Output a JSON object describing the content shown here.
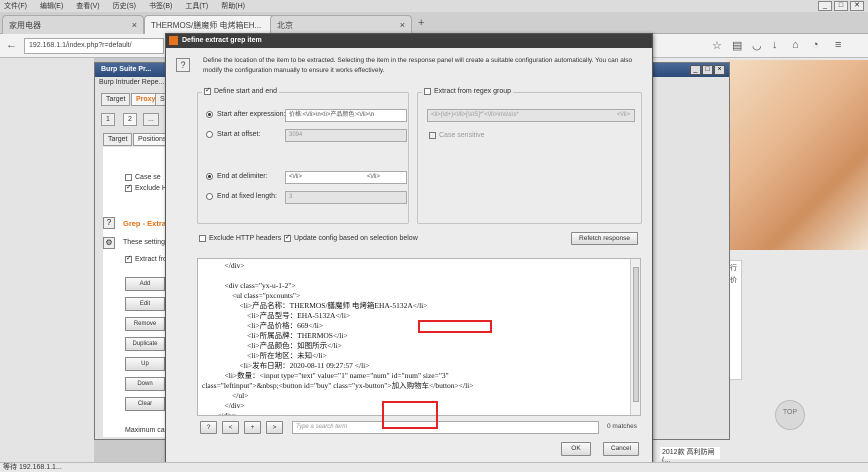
{
  "browser": {
    "menu": [
      "文件(F)",
      "编辑(E)",
      "查看(V)",
      "历史(S)",
      "书签(B)",
      "工具(T)",
      "帮助(H)"
    ],
    "tabs": [
      {
        "label": "家用电器"
      },
      {
        "label": "THERMOS/膳魔师 电烤箱EH..."
      },
      {
        "label": "北京"
      }
    ],
    "url": "192.168.1.1/index.php?r=default/",
    "status": "等待 192.168.1.1...",
    "right_side_text": "逛行\n降价\n有\n原",
    "footer_text": "2012款 高利防闸(...",
    "back_to_top": "TOP"
  },
  "burp": {
    "title": "Burp Suite Pr...",
    "menu": "Burp  Intruder  Repe...",
    "tabs_row1": [
      "Target",
      "Proxy",
      "S"
    ],
    "tabs_row2": [
      "1",
      "2",
      "..."
    ],
    "tabs_row3": [
      "Target",
      "Positions"
    ],
    "checks": [
      {
        "label": "Case se",
        "on": false
      },
      {
        "label": "Exclude H",
        "on": true
      }
    ],
    "grep_title": "Grep - Extra",
    "grep_desc": "These setting",
    "extract_label": "Extract fro",
    "buttons": [
      "Add",
      "Edit",
      "Remove",
      "Duplicate",
      "Up",
      "Down",
      "Clear"
    ],
    "max_label": "Maximum ca"
  },
  "dialog": {
    "title": "Define extract grep item",
    "help": "?",
    "intro": "Define the location of the item to be extracted. Selecting the item in the response panel will create a suitable configuration automatically. You can also modify the configuration manually to ensure it works effectively.",
    "left_group": {
      "label": "Define start and end",
      "start_after": {
        "label": "Start after expression:",
        "value": "价格:<\\/li>\\n<li>产品颜色:<\\/li>\\n"
      },
      "start_offset": {
        "label": "Start at offset:",
        "value": "3094"
      },
      "end_delimiter": {
        "label": "End at delimiter:",
        "value": "<\\/li>",
        "tail": "<\\/li>"
      },
      "end_length": {
        "label": "End at fixed length:",
        "value": "3"
      }
    },
    "right_group": {
      "label": "Extract from regex group",
      "regex_value": "<li>(\\d+)<\\/li>[\\s\\S]*\"<\\/li>\\n\\s\\s\\s*",
      "regex_end": "<\\/li>",
      "case_label": "Case sensitive"
    },
    "exclude_label": "Exclude HTTP headers",
    "update_label": "Update config based on selection below",
    "refetch": "Refetch response",
    "code": [
      {
        "indent": "            ",
        "text": "</div>"
      },
      {
        "indent": "",
        "text": ""
      },
      {
        "indent": "            ",
        "text": "<div class=\"yx-u-1-2\">"
      },
      {
        "indent": "                ",
        "text": "<ul class=\"pxcounts\">"
      },
      {
        "indent": "                    ",
        "text": "<li>产品名称：THERMOS/膳魔师 电烤箱EHA-5132A</li>"
      },
      {
        "indent": "                        ",
        "text": "<li>产品型号：EHA-5132A</li>"
      },
      {
        "indent": "                        ",
        "text": "<li>产品价格：669</li>"
      },
      {
        "indent": "                        ",
        "text": "<li>所属品牌：THERMOS</li>"
      },
      {
        "indent": "                        ",
        "text": "<li>产品颜色：如图所示</li>"
      },
      {
        "indent": "                        ",
        "text": "<li>所在地区：未知</li>"
      },
      {
        "indent": "                    ",
        "text": "<li>发布日期：2020-08-11 09:27:57 </li>"
      },
      {
        "indent": "            ",
        "text": "<li>数量：<input type=\"text\" value=\"1\" name=\"num\" id=\"num\" size=\"3\""
      },
      {
        "indent": "",
        "text": "class=\"leftinput\">&nbsp;<button id=\"buy\" class=\"yx-button\">加入购物车</button></li>"
      },
      {
        "indent": "                ",
        "text": "</ul>"
      },
      {
        "indent": "            ",
        "text": "</div>"
      },
      {
        "indent": "        ",
        "text": "</div>"
      }
    ],
    "highlight": "669",
    "search_buttons": [
      "?",
      "<",
      "+",
      ">"
    ],
    "search_placeholder": "Type a search term",
    "matches": "0 matches",
    "ok": "OK",
    "cancel": "Cancel"
  }
}
